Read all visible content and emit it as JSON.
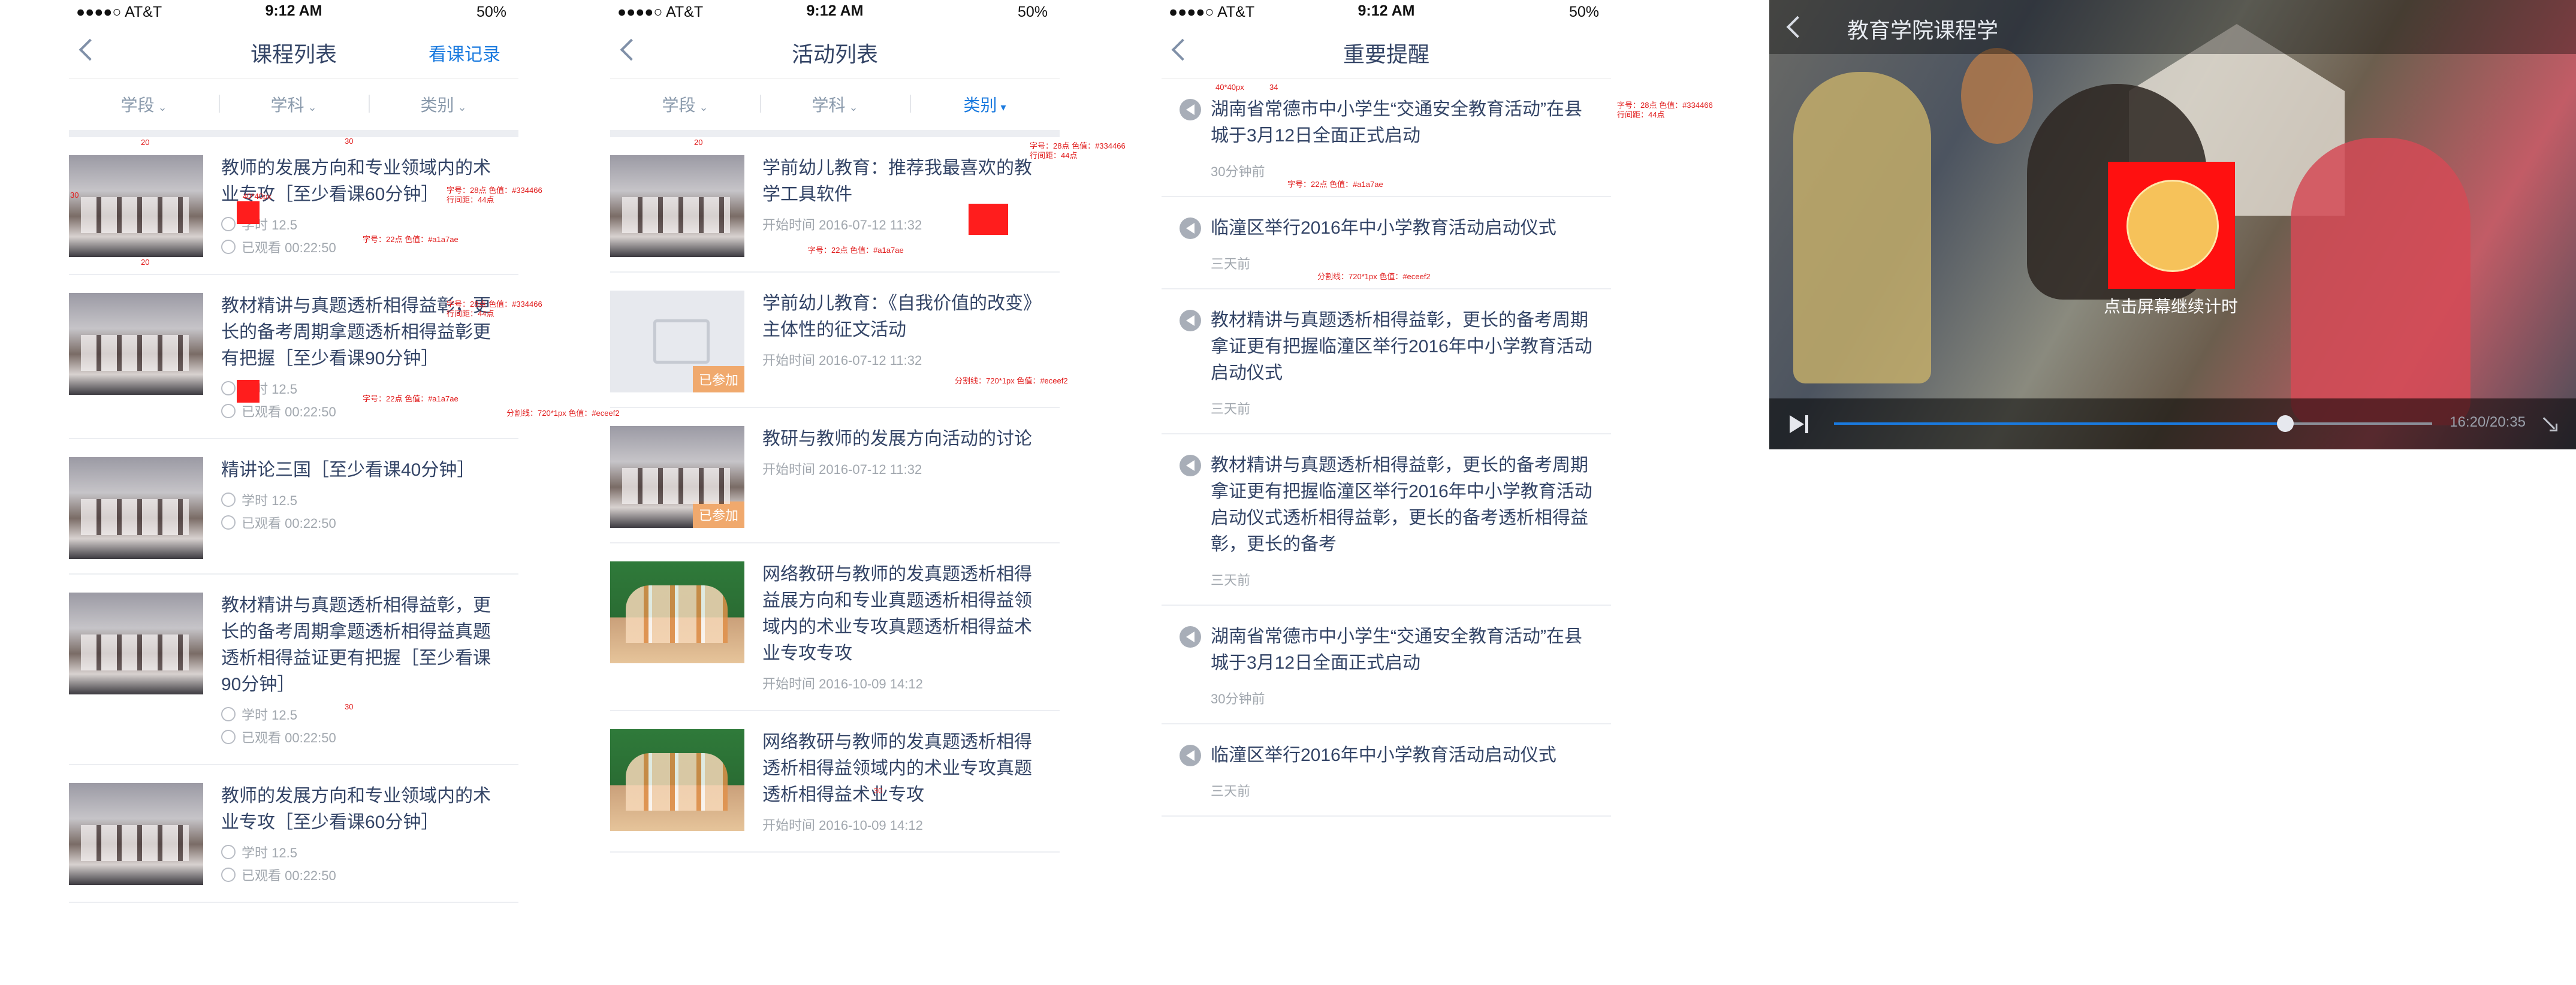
{
  "status": {
    "carrier": "●●●●○ AT&T",
    "time": "9:12 AM",
    "battery": "50%"
  },
  "course_list": {
    "title": "课程列表",
    "right_action": "看课记录",
    "filters": [
      "学段",
      "学科",
      "类别"
    ],
    "items": [
      {
        "title": "教师的发展方向和专业领域内的术业专攻［至少看课60分钟］",
        "hours": "学时 12.5",
        "watched": "已观看 00:22:50"
      },
      {
        "title": "教材精讲与真题透析相得益彰，更长的备考周期拿题透析相得益彰更有把握［至少看课90分钟］",
        "hours": "学时 12.5",
        "watched": "已观看 00:22:50"
      },
      {
        "title": "精讲论三国［至少看课40分钟］",
        "hours": "学时 12.5",
        "watched": "已观看 00:22:50"
      },
      {
        "title": "教材精讲与真题透析相得益彰，更长的备考周期拿题透析相得益真题透析相得益证更有把握［至少看课90分钟］",
        "hours": "学时 12.5",
        "watched": "已观看 00:22:50"
      },
      {
        "title": "教师的发展方向和专业领域内的术业专攻［至少看课60分钟］",
        "hours": "学时 12.5",
        "watched": "已观看 00:22:50"
      }
    ]
  },
  "activity_list": {
    "title": "活动列表",
    "filters": [
      "学段",
      "学科",
      "类别"
    ],
    "items": [
      {
        "title": "学前幼儿教育：推荐我最喜欢的教学工具软件",
        "time": "开始时间 2016-07-12 11:32",
        "tag": ""
      },
      {
        "title": "学前幼儿教育：《自我价值的改变》主体性的征文活动",
        "time": "开始时间 2016-07-12 11:32",
        "tag": "已参加"
      },
      {
        "title": "教研与教师的发展方向活动的讨论",
        "time": "开始时间 2016-07-12 11:32",
        "tag": "已参加"
      },
      {
        "title": "网络教研与教师的发真题透析相得益展方向和专业真题透析相得益领域内的术业专攻真题透析相得益术业专攻专攻",
        "time": "开始时间 2016-10-09 14:12",
        "tag": ""
      },
      {
        "title": "网络教研与教师的发真题透析相得透析相得益领域内的术业专攻真题透析相得益术业专攻",
        "time": "开始时间 2016-10-09 14:12",
        "tag": ""
      }
    ]
  },
  "reminders": {
    "title": "重要提醒",
    "items": [
      {
        "title": "湖南省常德市中小学生“交通安全教育活动”在县城于3月12日全面正式启动",
        "time": "30分钟前"
      },
      {
        "title": "临潼区举行2016年中小学教育活动启动仪式",
        "time": "三天前"
      },
      {
        "title": "教材精讲与真题透析相得益彰，更长的备考周期拿证更有把握临潼区举行2016年中小学教育活动启动仪式",
        "time": "三天前"
      },
      {
        "title": "教材精讲与真题透析相得益彰，更长的备考周期拿证更有把握临潼区举行2016年中小学教育活动启动仪式透析相得益彰，更长的备考透析相得益彰，更长的备考",
        "time": "三天前"
      },
      {
        "title": "湖南省常德市中小学生“交通安全教育活动”在县城于3月12日全面正式启动",
        "time": "30分钟前"
      },
      {
        "title": "临潼区举行2016年中小学教育活动启动仪式",
        "time": "三天前"
      }
    ]
  },
  "video": {
    "title": "教育学院课程学",
    "resume_text": "点击屏幕继续计时",
    "time": "16:20/20:35",
    "progress": 0.755
  },
  "annotations": {
    "title_spec": "字号：28点  色值：#334466",
    "line_height": "行间距：44点",
    "meta_spec": "字号：22点  色值：#a1a7ae",
    "divider_spec": "分割线：720*1px  色值：#eceef2",
    "icon_spec": "40*40px",
    "sizes": [
      "20",
      "30",
      "22",
      "24",
      "34"
    ]
  },
  "colors": {
    "primary_text": "#334466",
    "secondary_text": "#a1a7ae",
    "accent": "#1a7adf",
    "divider": "#eceef2",
    "tag": "#f0a96d"
  }
}
